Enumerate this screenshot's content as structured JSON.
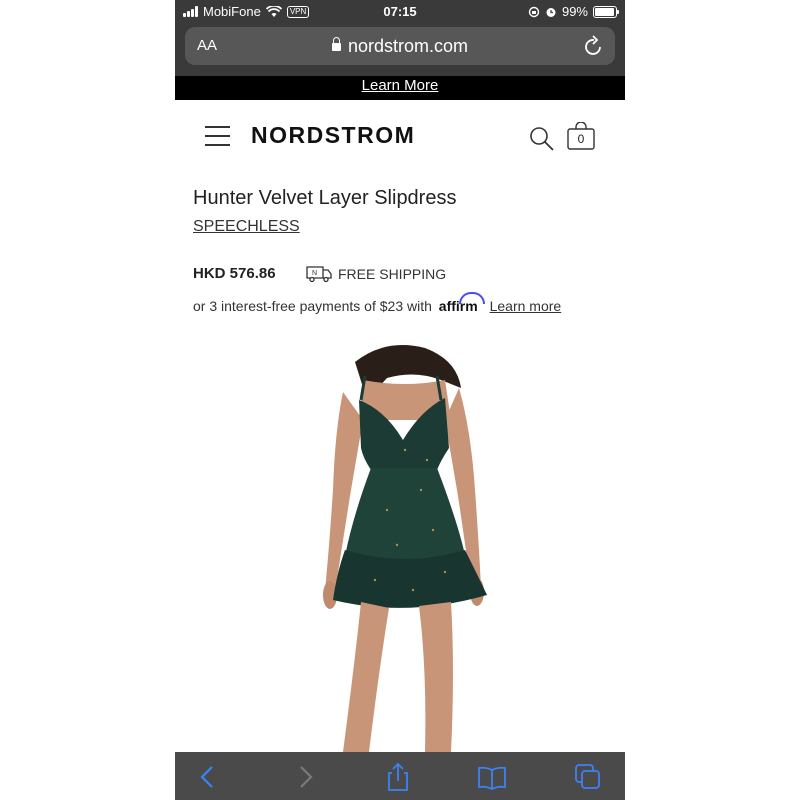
{
  "status_bar": {
    "carrier": "MobiFone",
    "vpn": "VPN",
    "time": "07:15",
    "battery": "99%"
  },
  "browser": {
    "text_size_label": "AA",
    "url": "nordstrom.com"
  },
  "promo": {
    "link_text": "Learn More"
  },
  "header": {
    "logo": "NORDSTROM",
    "bag_count": "0"
  },
  "product": {
    "title": "Hunter Velvet Layer Slipdress",
    "brand": "SPEECHLESS",
    "price": "HKD 576.86",
    "shipping": "FREE SHIPPING",
    "installments_text": "or 3 interest-free payments of $23 with",
    "affirm_logo": "affirm",
    "learn_more": "Learn more",
    "image_icon": "dress-photo"
  },
  "toolbar": {
    "icons": [
      "back-icon",
      "forward-icon",
      "share-icon",
      "bookmarks-icon",
      "tabs-icon"
    ]
  },
  "colors": {
    "accent_blue": "#3b82f6",
    "affirm_blue": "#4a4af4",
    "dress_green": "#1c3b34"
  }
}
